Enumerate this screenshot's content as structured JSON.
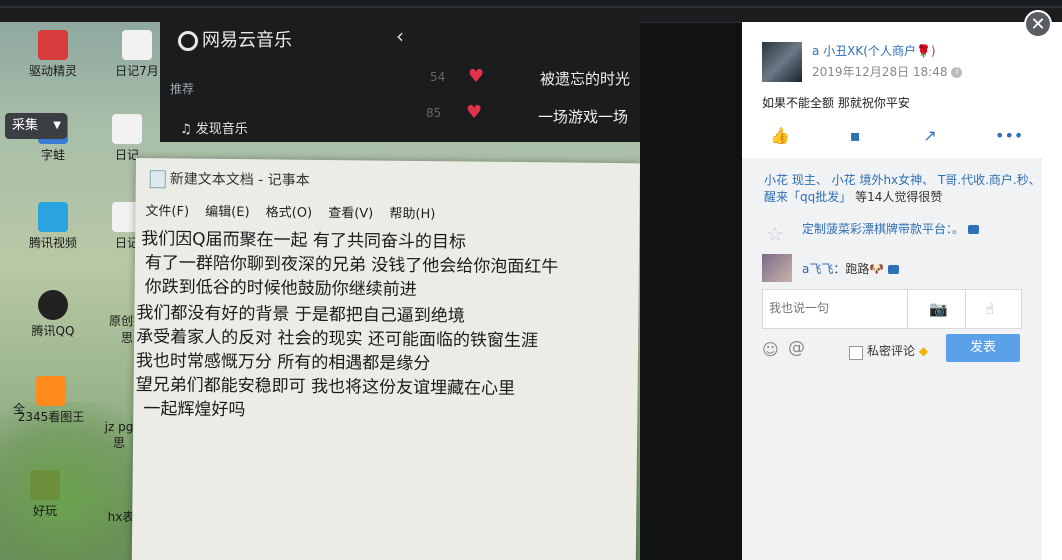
{
  "photo": {
    "music_app": {
      "logo": "网易云音乐",
      "section": "推荐",
      "menu_item": "发现音乐",
      "rows": [
        {
          "num": "54",
          "title": "被遗忘的时光"
        },
        {
          "num": "85",
          "title": "一场游戏一场"
        }
      ]
    },
    "desktop_icons": [
      "驱动精灵",
      "日记7月",
      "字蛙",
      "日记",
      "腾讯视频",
      "日记",
      "腾讯QQ",
      "原创抖",
      "思",
      "全",
      "2345看图王",
      "jz pg",
      "思",
      "好玩",
      "hx表"
    ],
    "notepad": {
      "title": "新建文本文档 - 记事本",
      "menu": [
        "文件(F)",
        "编辑(E)",
        "格式(O)",
        "查看(V)",
        "帮助(H)"
      ],
      "lines": [
        "我们因Q届而聚在一起 有了共同奋斗的目标",
        "有了一群陪你聊到夜深的兄弟 没钱了他会给你泡面红牛",
        "你跌到低谷的时候他鼓励你继续前进",
        "我们都没有好的背景 于是都把自己逼到绝境",
        "承受着家人的反对 社会的现实 还可能面临的铁窗生涯",
        "我也时常感慨万分 所有的相遇都是缘分",
        "望兄弟们都能安稳即可 我也将这份友谊埋藏在心里",
        "一起辉煌好吗"
      ]
    },
    "collect_button": "采集"
  },
  "panel": {
    "author": "a 小丑XK(个人商户",
    "author_suffix": "🌹)",
    "time": "2019年12月28日 18:48",
    "text": "如果不能全额 那就祝你平安",
    "likes": {
      "names": "小花 现主、 小花 境外hx女神、 T哥.代收.商户.秒、 醒来「qq批发」",
      "suffix": "等14人觉得很赞"
    },
    "ad": "定制菠菜彩漂棋牌带款平台：。",
    "comment": {
      "user": "a飞飞",
      "text": "：跑路🐶"
    },
    "input_placeholder": "我也说一句",
    "private_label": "私密评论",
    "send_label": "发表"
  },
  "colors": {
    "link": "#2e6fb5",
    "send": "#5aa1e8"
  }
}
